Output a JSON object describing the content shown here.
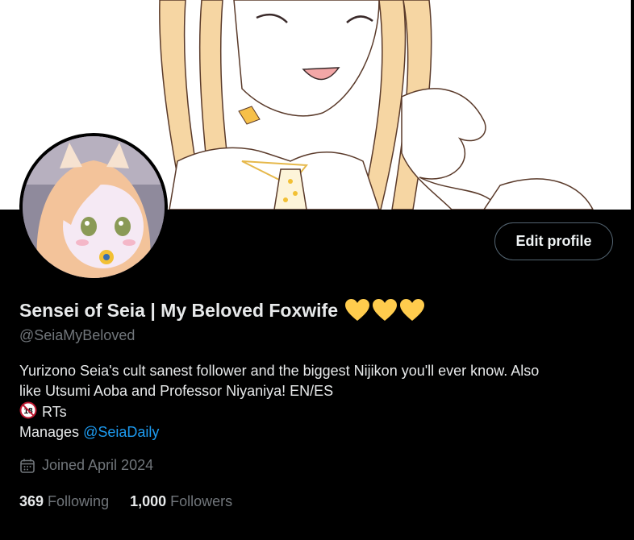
{
  "profile": {
    "display_name": "Sensei of Seia | My Beloved Foxwife",
    "name_emoji": [
      "yellow-heart",
      "yellow-heart",
      "yellow-heart"
    ],
    "handle": "@SeiaMyBeloved",
    "edit_profile_label": "Edit profile"
  },
  "bio": {
    "line1": "Yurizono Seia's cult sanest follower and the biggest Nijikon you'll ever know. Also",
    "line2": "like Utsumi Aoba and Professor Niyaniya! EN/ES",
    "line3_icon": "no-under-18-icon",
    "line3_text": "RTs",
    "line4_prefix": "Manages",
    "line4_mention": "@SeiaDaily"
  },
  "joined": {
    "icon": "calendar-icon",
    "text": "Joined April 2024"
  },
  "stats": {
    "following_count": "369",
    "following_label": "Following",
    "followers_count": "1,000",
    "followers_label": "Followers"
  },
  "colors": {
    "background": "#000000",
    "text_primary": "#e7e9ea",
    "text_secondary": "#71767b",
    "link": "#1d9bf0",
    "button_border": "#536471",
    "heart": "#ffcc4d",
    "no18_red": "#be1931"
  }
}
